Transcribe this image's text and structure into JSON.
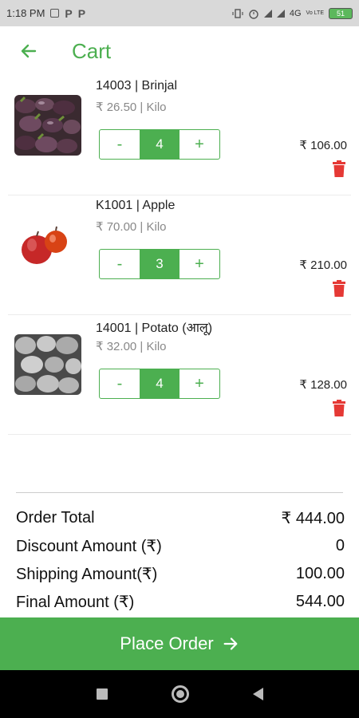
{
  "status_bar": {
    "time": "1:18 PM",
    "network": "4G",
    "volte": "Vo LTE",
    "battery": "51"
  },
  "app_bar": {
    "title": "Cart"
  },
  "items": [
    {
      "name": "14003 | Brinjal",
      "price": "₹ 26.50 | Kilo",
      "quantity": "4",
      "line_total": "₹ 106.00",
      "image": "brinjal-image"
    },
    {
      "name": "K1001 | Apple",
      "price": "₹ 70.00 | Kilo",
      "quantity": "3",
      "line_total": "₹ 210.00",
      "image": "apple-image"
    },
    {
      "name": "14001 | Potato (आलू)",
      "price": "₹ 32.00 | Kilo",
      "quantity": "4",
      "line_total": "₹ 128.00",
      "image": "potato-image"
    }
  ],
  "qty_controls": {
    "minus": "-",
    "plus": "+"
  },
  "totals": {
    "order_total_label": "Order Total",
    "order_total_value": "₹ 444.00",
    "discount_label": "Discount Amount (₹)",
    "discount_value": "0",
    "shipping_label": "Shipping Amount(₹)",
    "shipping_value": "100.00",
    "final_label": "Final Amount (₹)",
    "final_value": "544.00"
  },
  "place_order": {
    "label": "Place Order",
    "icon": "arrow-right-icon"
  },
  "colors": {
    "accent": "#4caf50",
    "delete": "#e53935"
  }
}
